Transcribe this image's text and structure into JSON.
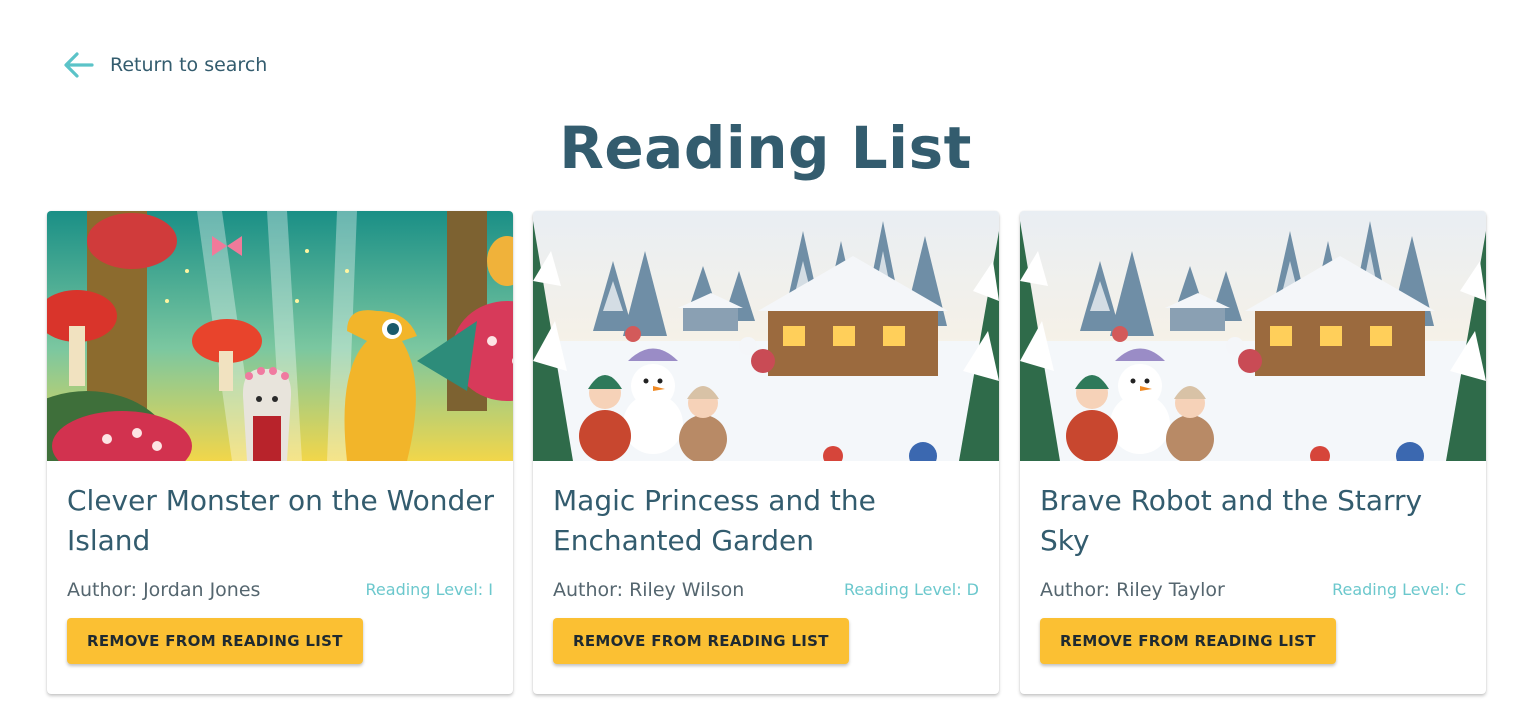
{
  "nav": {
    "back_label": "Return to search",
    "back_icon": "arrow-left-icon",
    "accent": "#5bc3c8"
  },
  "page": {
    "title": "Reading List"
  },
  "colors": {
    "heading": "#335c6e",
    "level": "#6cc8cd",
    "button": "#fbc033"
  },
  "books": [
    {
      "title": "Clever Monster on the Wonder Island",
      "author": "Author: Jordan Jones",
      "level": "Reading Level: I",
      "button": "REMOVE FROM READING LIST",
      "image": "fantasy-forest-dragon-illustration"
    },
    {
      "title": "Magic Princess and the Enchanted Garden",
      "author": "Author: Riley Wilson",
      "level": "Reading Level: D",
      "button": "REMOVE FROM READING LIST",
      "image": "winter-snowman-cabin-illustration"
    },
    {
      "title": "Brave Robot and the Starry Sky",
      "author": "Author: Riley Taylor",
      "level": "Reading Level: C",
      "button": "REMOVE FROM READING LIST",
      "image": "winter-snowman-cabin-illustration"
    }
  ]
}
